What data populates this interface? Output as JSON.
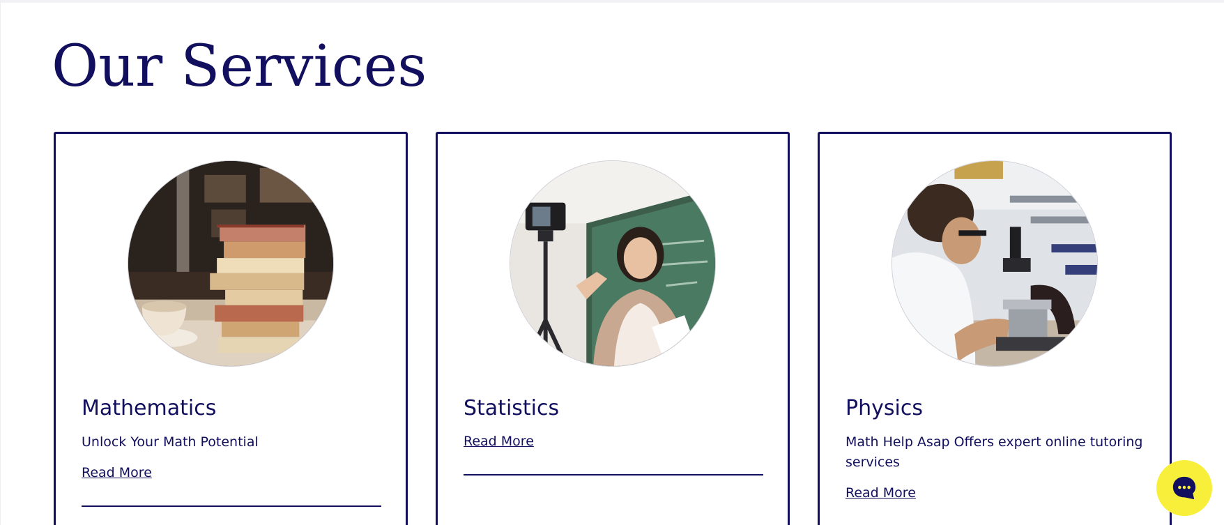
{
  "section": {
    "title": "Our Services"
  },
  "cards": [
    {
      "title": "Mathematics",
      "description": "Unlock Your Math Potential",
      "link_label": "Read More",
      "image_icon": "stack-of-books-photo"
    },
    {
      "title": "Statistics",
      "description": "",
      "link_label": "Read More",
      "image_icon": "teacher-with-camera-photo"
    },
    {
      "title": "Physics",
      "description": "Math Help Asap Offers expert online tutoring services",
      "link_label": "Read More",
      "image_icon": "student-with-microscope-photo"
    }
  ],
  "chat": {
    "icon": "chat-bubble-icon"
  },
  "colors": {
    "brand_navy": "#12105e",
    "chat_yellow": "#f7ef3a",
    "background": "#ffffff"
  }
}
